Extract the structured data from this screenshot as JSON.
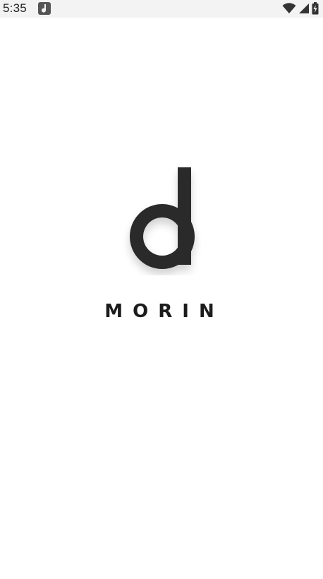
{
  "status_bar": {
    "time": "5:35",
    "notification_icon": "music-app-icon",
    "wifi_icon": "wifi-icon",
    "signal_icon": "cell-signal-icon",
    "battery_icon": "battery-charging-icon"
  },
  "splash": {
    "logo_icon": "morin-d-logo-icon",
    "wordmark": "MORIN"
  },
  "colors": {
    "logo": "#2a2a2a",
    "background": "#ffffff",
    "status_bar": "#f3f3f3"
  }
}
